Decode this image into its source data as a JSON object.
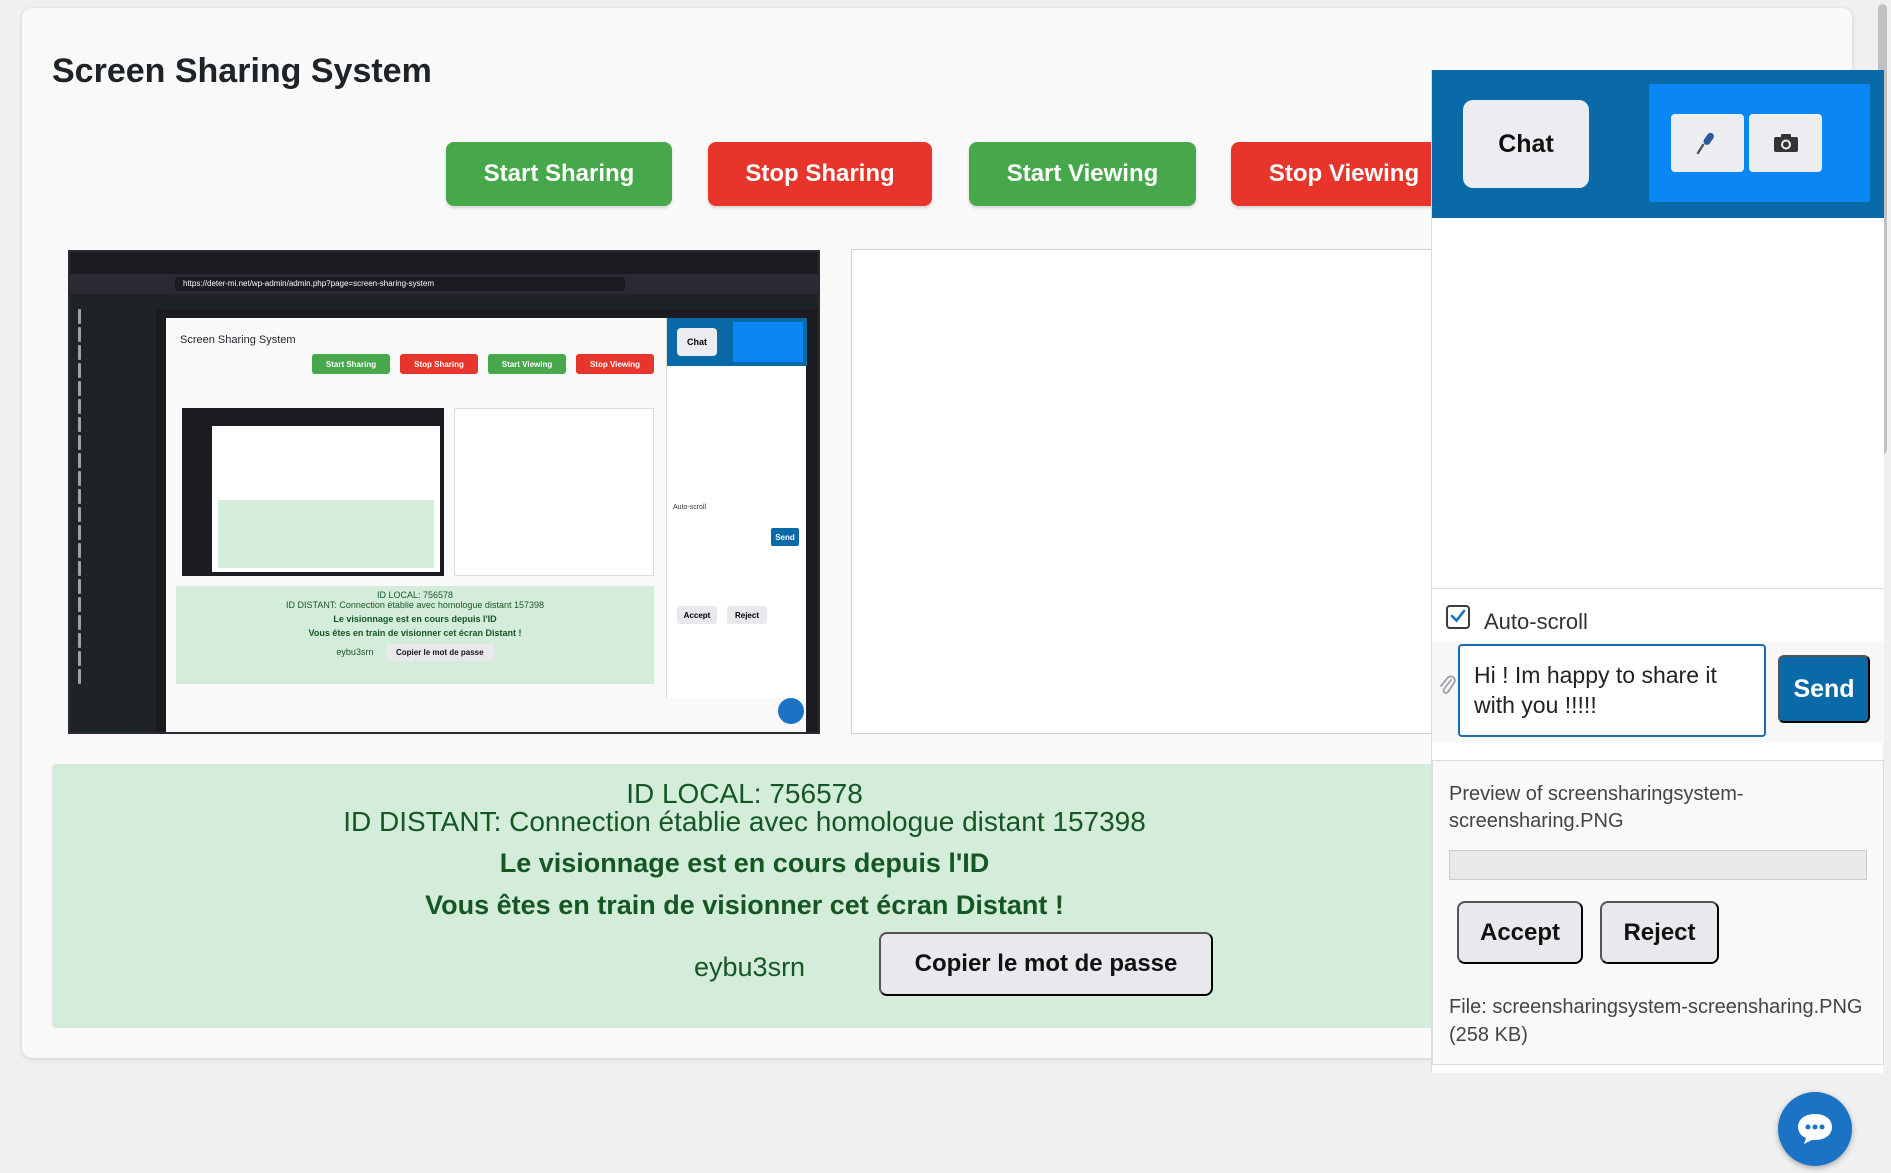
{
  "page": {
    "title": "Screen Sharing System"
  },
  "controls": {
    "start_sharing": "Start Sharing",
    "stop_sharing": "Stop Sharing",
    "start_viewing": "Start Viewing",
    "stop_viewing": "Stop Viewing"
  },
  "status": {
    "local_id": "ID LOCAL: 756578",
    "remote_id": "ID DISTANT: Connection établie avec homologue distant 157398",
    "viewing_line": "Le visionnage est en cours depuis l'ID",
    "remote_view_line": "Vous êtes en train de visionner cet écran Distant !",
    "password": "eybu3srn",
    "copy_password": "Copier le mot de passe"
  },
  "chat": {
    "tab_label": "Chat",
    "mic_icon": "microphone-icon",
    "camera_icon": "camera-icon",
    "autoscroll_label": "Auto-scroll",
    "autoscroll_checked": true,
    "message_value": "Hi ! Im happy to share it with you !!!!!",
    "send_label": "Send",
    "preview_title": "Preview of screensharingsystem-screensharing.PNG",
    "accept_label": "Accept",
    "reject_label": "Reject",
    "file_info": "File: screensharingsystem-screensharing.PNG (258 KB)"
  },
  "colors": {
    "green": "#46a84a",
    "red": "#e8352b",
    "chat_header": "#0a6aa8",
    "media_box": "#0b86f5",
    "status_bg": "#d4edda",
    "status_text": "#155724"
  },
  "shared_screen": {
    "url": "https://deter-mi.net/wp-admin/admin.php?page=screen-sharing-system",
    "page_title": "Screen Sharing System",
    "start_sharing": "Start Sharing",
    "stop_sharing": "Stop Sharing",
    "start_viewing": "Start Viewing",
    "stop_viewing": "Stop Viewing",
    "chat": "Chat",
    "local_id": "ID LOCAL: 756578",
    "remote_id": "ID DISTANT: Connection établie avec homologue distant 157398",
    "viewing_line": "Le visionnage est en cours depuis l'ID",
    "remote_view_line": "Vous êtes en train de visionner cet écran Distant !",
    "password": "eybu3srn",
    "copy_password": "Copier le mot de passe",
    "autoscroll": "Auto-scroll",
    "send": "Send",
    "accept": "Accept",
    "reject": "Reject"
  }
}
